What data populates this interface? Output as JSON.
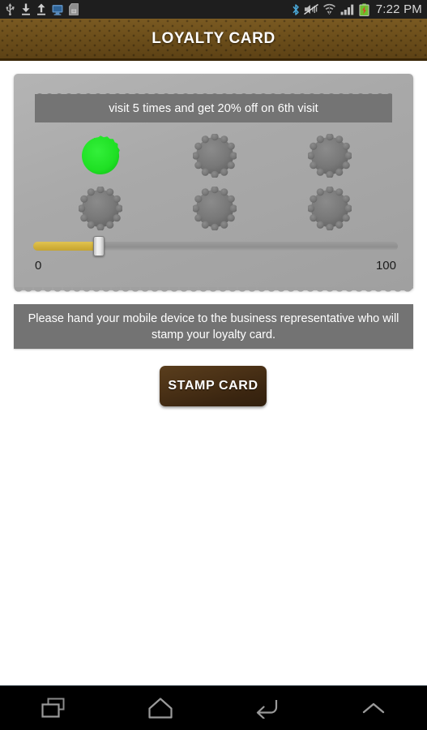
{
  "status_bar": {
    "icons_left": [
      "usb-icon",
      "download-icon",
      "upload-icon",
      "adb-monitor-icon",
      "sd-card-icon"
    ],
    "icons_right": [
      "bluetooth-icon",
      "mute-vibrate-icon",
      "wifi-icon",
      "signal-bars-icon",
      "battery-charging-icon"
    ],
    "clock": "7:22 PM"
  },
  "app_bar": {
    "title": "LOYALTY CARD"
  },
  "card": {
    "banner_text": "visit 5 times and get 20% off on 6th visit",
    "stamps": [
      {
        "label": "stamp-1",
        "state": "stamped"
      },
      {
        "label": "stamp-2",
        "state": "empty"
      },
      {
        "label": "stamp-3",
        "state": "empty"
      },
      {
        "label": "stamp-4",
        "state": "empty"
      },
      {
        "label": "stamp-5",
        "state": "empty"
      },
      {
        "label": "stamp-6",
        "state": "empty"
      }
    ],
    "slider": {
      "value": 17,
      "min_label": "0",
      "max_label": "100"
    }
  },
  "instruction": {
    "text": "Please hand your mobile device to the business representative who will stamp your loyalty card."
  },
  "actions": {
    "stamp_card_label": "STAMP CARD"
  },
  "nav_bar": {
    "items": [
      "recents-icon",
      "home-icon",
      "back-icon",
      "chevron-up-icon"
    ]
  },
  "colors": {
    "app_bar_brown": "#6e4f1c",
    "stamped_green": "#1fe024",
    "slider_gold": "#d2b13b",
    "button_brown": "#3a2510",
    "panel_gray": "#737373"
  }
}
